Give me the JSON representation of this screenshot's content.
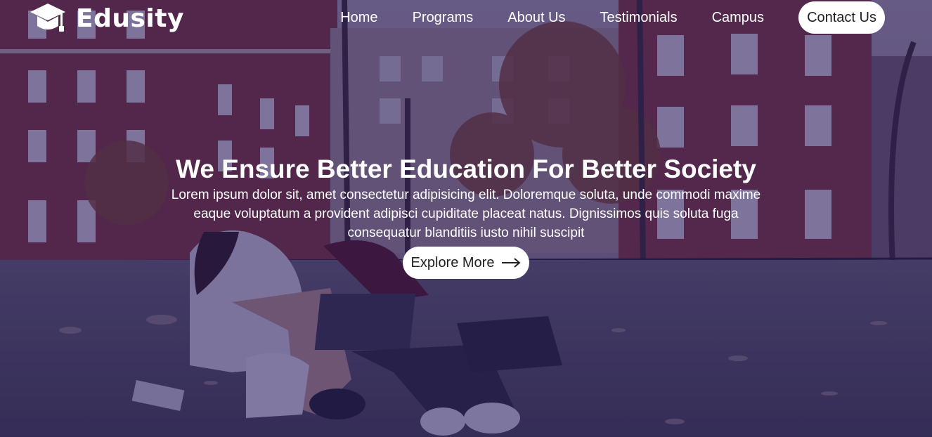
{
  "brand": {
    "name": "Edusity",
    "icon": "graduation-cap-icon"
  },
  "nav": {
    "items": [
      "Home",
      "Programs",
      "About Us",
      "Testimonials",
      "Campus"
    ],
    "contact_label": "Contact Us"
  },
  "hero": {
    "title": "We Ensure Better Education For Better Society",
    "description": "Lorem ipsum dolor sit, amet consectetur adipisicing elit. Doloremque soluta, unde commodi maxime eaque voluptatum a provident adipisci cupiditate placeat natus. Dignissimos quis soluta fuga consequatur blanditiis iusto nihil suscipit",
    "button_label": "Explore More",
    "button_icon": "arrow-right-icon"
  },
  "colors": {
    "overlay": "#24185c",
    "button_bg": "#ffffff",
    "button_text": "#212121",
    "text": "#ffffff"
  }
}
